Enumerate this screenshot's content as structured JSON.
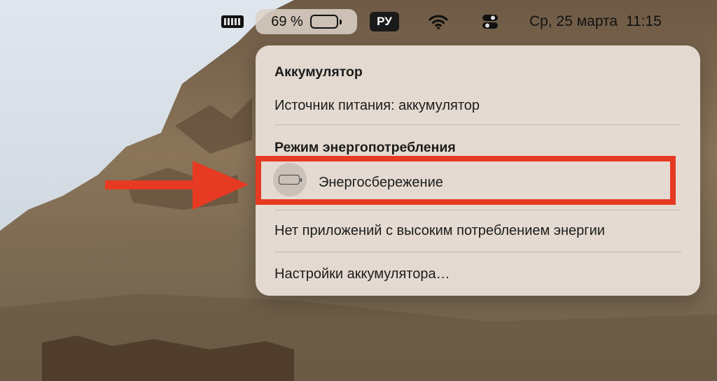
{
  "menubar": {
    "battery_percent": "69 %",
    "battery_level": 0.69,
    "lang": "РУ",
    "datetime": "Ср, 25 марта  11:15",
    "icons": [
      "memory-icon",
      "battery-icon",
      "wifi-icon",
      "control-center-icon"
    ]
  },
  "panel": {
    "title": "Аккумулятор",
    "power_source": "Источник питания: аккумулятор",
    "energy_mode_header": "Режим энергопотребления",
    "low_power_label": "Энергосбережение",
    "no_apps": "Нет приложений с высоким потреблением энергии",
    "settings": "Настройки аккумулятора…"
  },
  "colors": {
    "highlight": "#e63a22",
    "panel_bg": "#ece2da"
  }
}
